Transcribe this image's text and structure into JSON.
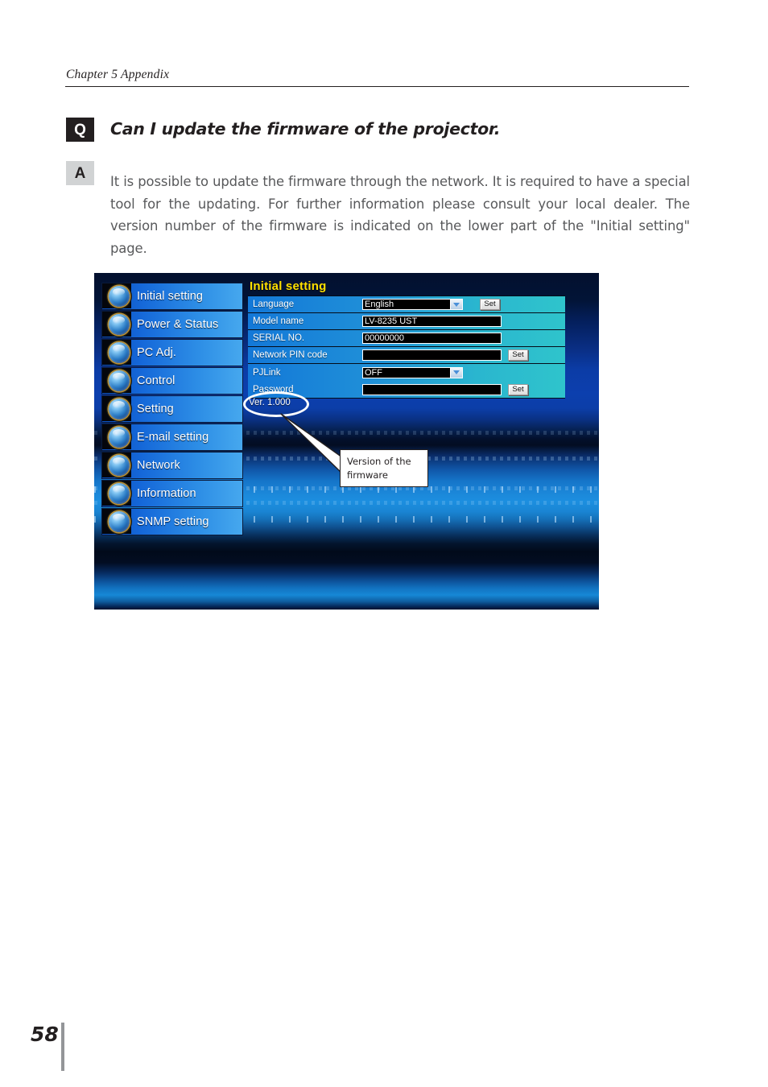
{
  "page": {
    "running_head": "Chapter 5 Appendix",
    "folio": "58"
  },
  "faq": {
    "question_badge": "Q",
    "question": "Can I update the firmware of the projector.",
    "answer_badge": "A",
    "answer": "It is possible to update the firmware through the network. It is required to have a special tool for the updating. For further information please consult your local dealer. The version number of the firmware is indicated on the lower part of the \"Initial setting\" page."
  },
  "screenshot": {
    "sidebar": {
      "items": [
        {
          "label": "Initial setting",
          "icon": "initial-setting-icon"
        },
        {
          "label": "Power & Status",
          "icon": "power-status-icon"
        },
        {
          "label": "PC Adj.",
          "icon": "pc-adjust-icon"
        },
        {
          "label": "Control",
          "icon": "control-icon"
        },
        {
          "label": "Setting",
          "icon": "setting-icon"
        },
        {
          "label": "E-mail setting",
          "icon": "email-setting-icon"
        },
        {
          "label": "Network",
          "icon": "network-icon"
        },
        {
          "label": "Information",
          "icon": "information-icon"
        },
        {
          "label": "SNMP setting",
          "icon": "snmp-setting-icon"
        }
      ]
    },
    "panel": {
      "title": "Initial setting",
      "title_color": "#ffe000",
      "rows": [
        {
          "label": "Language",
          "value": "English",
          "control": "select",
          "button": "Set"
        },
        {
          "label": "Model name",
          "value": "LV-8235 UST",
          "control": "text",
          "button": ""
        },
        {
          "label": "SERIAL NO.",
          "value": "00000000",
          "control": "text",
          "button": ""
        },
        {
          "label": "Network PIN code",
          "value": "",
          "control": "text",
          "button": "Set"
        },
        {
          "label": "PJLink",
          "value": "OFF",
          "control": "select",
          "button": ""
        },
        {
          "label": "Password",
          "value": "",
          "control": "text",
          "button": "Set"
        }
      ],
      "version": "Ver. 1.000"
    },
    "callout": {
      "line1": "Version of the",
      "line2": "firmware"
    }
  }
}
